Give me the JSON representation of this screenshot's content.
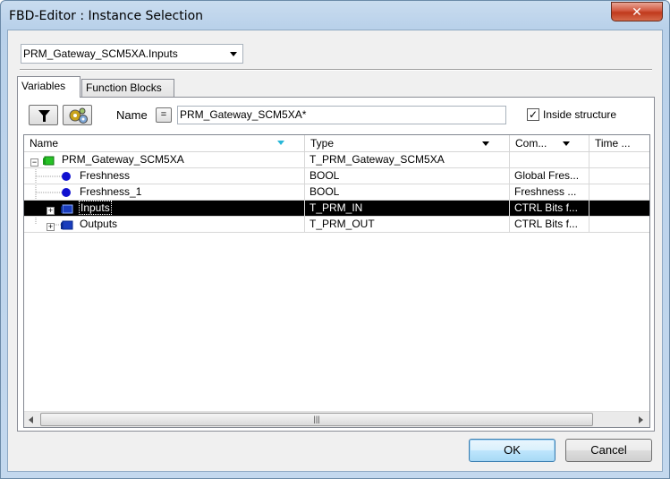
{
  "window": {
    "title": "FBD-Editor : Instance Selection",
    "close_glyph": "✕"
  },
  "instance_combo": {
    "value": "PRM_Gateway_SCM5XA.Inputs"
  },
  "tabs": [
    {
      "label": "Variables"
    },
    {
      "label": "Function Blocks"
    }
  ],
  "filter": {
    "name_label": "Name",
    "operator": "=",
    "value": "PRM_Gateway_SCM5XA*",
    "inside_structure": {
      "label": "Inside structure",
      "checked": true
    }
  },
  "grid": {
    "columns": [
      {
        "label": "Name"
      },
      {
        "label": "Type"
      },
      {
        "label": "Com..."
      },
      {
        "label": "Time ..."
      }
    ],
    "rows": [
      {
        "name": "PRM_Gateway_SCM5XA",
        "type": "T_PRM_Gateway_SCM5XA",
        "comment": "",
        "expander": "−",
        "icon": "struct-icon"
      },
      {
        "name": "Freshness",
        "type": "BOOL",
        "comment": "Global Fres...",
        "expander": "",
        "icon": "variable-icon"
      },
      {
        "name": "Freshness_1",
        "type": "BOOL",
        "comment": "Freshness ...",
        "expander": "",
        "icon": "variable-icon"
      },
      {
        "name": "Inputs",
        "type": "T_PRM_IN",
        "comment": "CTRL Bits f...",
        "expander": "+",
        "icon": "struct-icon",
        "selected": true
      },
      {
        "name": "Outputs",
        "type": "T_PRM_OUT",
        "comment": "CTRL Bits f...",
        "expander": "+",
        "icon": "struct-icon"
      }
    ],
    "scroll_grip": "|||"
  },
  "buttons": {
    "ok": "OK",
    "cancel": "Cancel"
  },
  "colors": {
    "selection": "#000000",
    "struct_icon": "#1a3dbd",
    "root_icon": "#27c327",
    "variable_icon": "#1010d0"
  }
}
